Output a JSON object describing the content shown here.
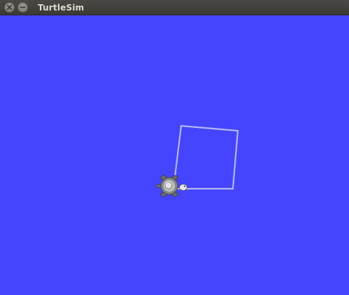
{
  "window": {
    "title": "TurtleSim",
    "buttons": {
      "close_icon": "close-icon",
      "minimize_icon": "minimize-icon"
    }
  },
  "canvas": {
    "background_color": "#4545ff",
    "pen_color": "#b3b8ff"
  },
  "turtle": {
    "icon": "turtle-icon"
  }
}
